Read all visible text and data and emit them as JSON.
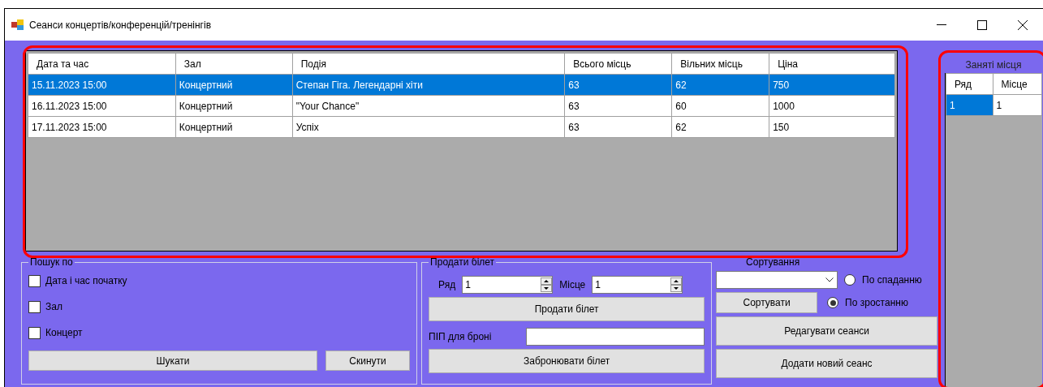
{
  "window": {
    "title": "Сеанси концертів/конференцій/тренінгів"
  },
  "sessions_table": {
    "columns": [
      "Дата та час",
      "Зал",
      "Подія",
      "Всього місць",
      "Вільних місць",
      "Ціна"
    ],
    "rows": [
      {
        "selected": true,
        "cells": [
          "15.11.2023 15:00",
          "Концертний",
          "Степан Гіга. Легендарні хіти",
          "63",
          "62",
          "750"
        ]
      },
      {
        "selected": false,
        "cells": [
          "16.11.2023 15:00",
          "Концертний",
          "\"Your Chance\"",
          "63",
          "60",
          "1000"
        ]
      },
      {
        "selected": false,
        "cells": [
          "17.11.2023 15:00",
          "Концертний",
          "Успіх",
          "63",
          "62",
          "150"
        ]
      }
    ]
  },
  "search_group": {
    "title": "Пошук по",
    "checkboxes": [
      {
        "label": "Дата і час початку",
        "checked": false
      },
      {
        "label": "Зал",
        "checked": false
      },
      {
        "label": "Концерт",
        "checked": false
      }
    ],
    "buttons": [
      "Шукати",
      "Скинути"
    ]
  },
  "sell_group": {
    "title": "Продати білет",
    "spinners": [
      {
        "label": "Ряд",
        "value": "1"
      },
      {
        "label": "Місце",
        "value": "1"
      }
    ],
    "sell_button": "Продати білет",
    "name_label": "ПІП для броні",
    "book_button": "Забронювати білет"
  },
  "sorting": {
    "title": "Сортування",
    "radios": [
      {
        "label": "По спаданню",
        "selected": false
      },
      {
        "label": "По зростанню",
        "selected": true
      }
    ],
    "sort_button": "Сортувати"
  },
  "actions": [
    "Редагувати сеанси",
    "Додати новий сеанс"
  ],
  "occupied_seats": {
    "title": "Заняті місця",
    "columns": [
      "Ряд",
      "Місце"
    ],
    "rows": [
      {
        "cells": [
          {
            "text": "1",
            "selected": true
          },
          {
            "text": "1",
            "selected": false
          }
        ]
      }
    ]
  },
  "annotations": [
    {
      "kind": "outline",
      "color": "#ff0000"
    },
    {
      "kind": "outline",
      "color": "#ff0000"
    }
  ]
}
